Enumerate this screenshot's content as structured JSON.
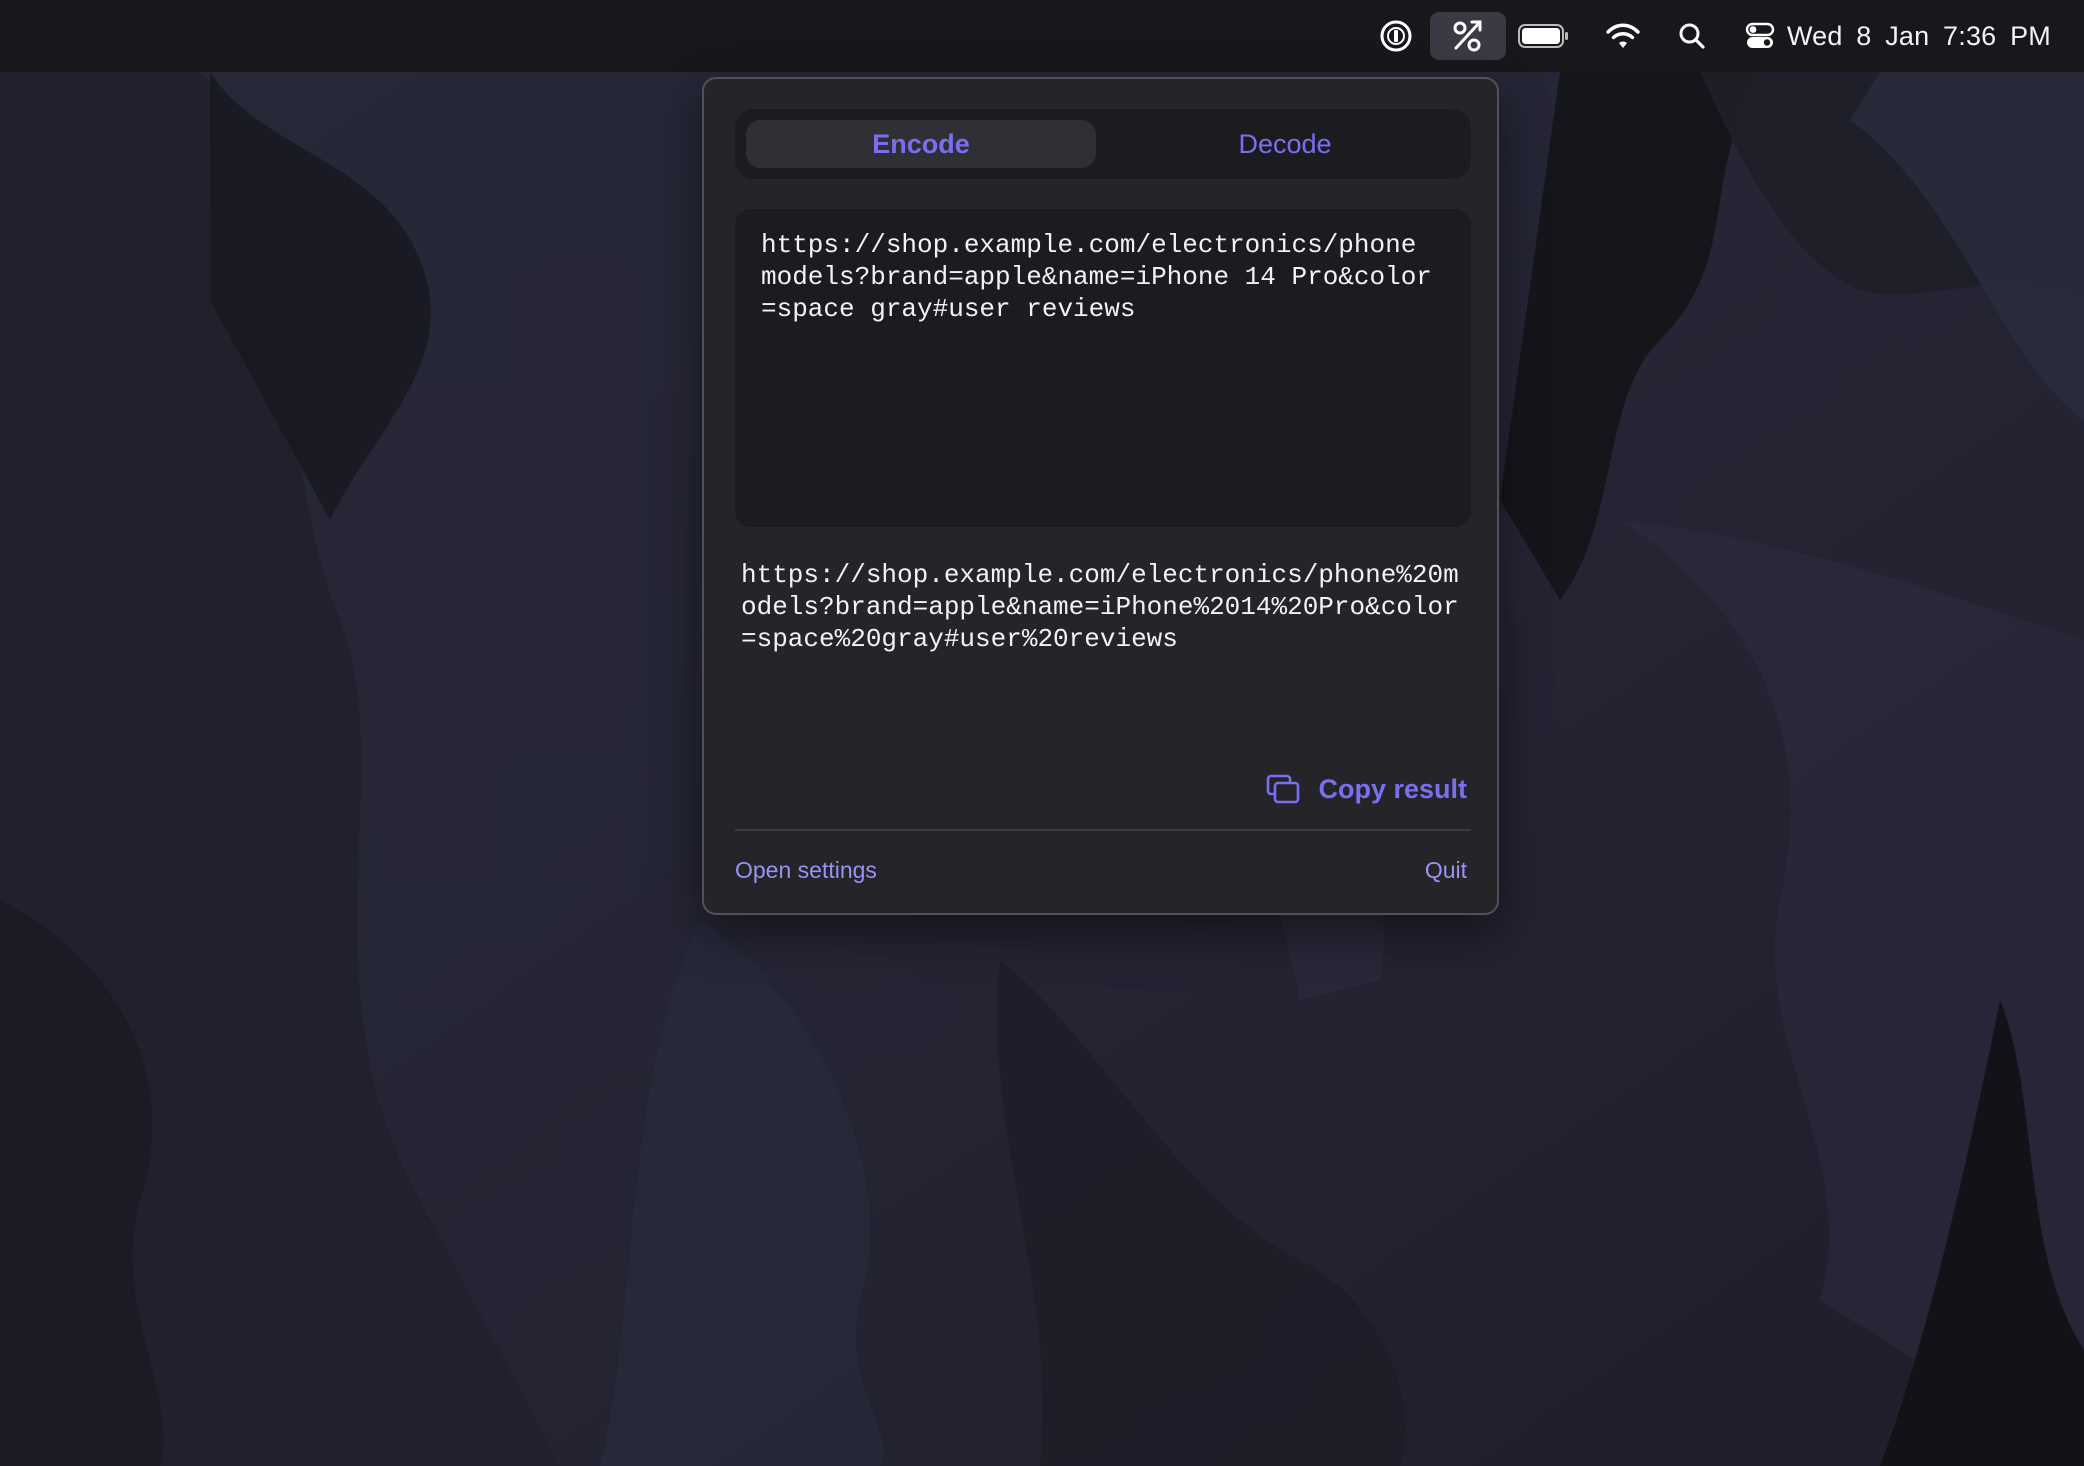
{
  "menubar": {
    "icons": [
      "password-manager-icon",
      "url-encoder-app-icon",
      "battery-icon",
      "wifi-icon",
      "search-icon",
      "control-center-icon"
    ],
    "clock": "Wed 8 Jan  7:36 PM"
  },
  "popover": {
    "tabs": {
      "encode": "Encode",
      "decode": "Decode",
      "selected": "Encode"
    },
    "input_text": "https://shop.example.com/electronics/phone models?brand=apple&name=iPhone 14 Pro&color=space gray#user reviews",
    "output_text": "https://shop.example.com/electronics/phone%20models?brand=apple&name=iPhone%2014%20Pro&color=space%20gray#user%20reviews",
    "copy_label": "Copy result",
    "open_settings_label": "Open settings",
    "quit_label": "Quit"
  },
  "colors": {
    "accent": "#7a6ff2",
    "menubar_bg": "#17171c",
    "popover_bg": "#252529",
    "field_bg": "#1c1c20"
  }
}
